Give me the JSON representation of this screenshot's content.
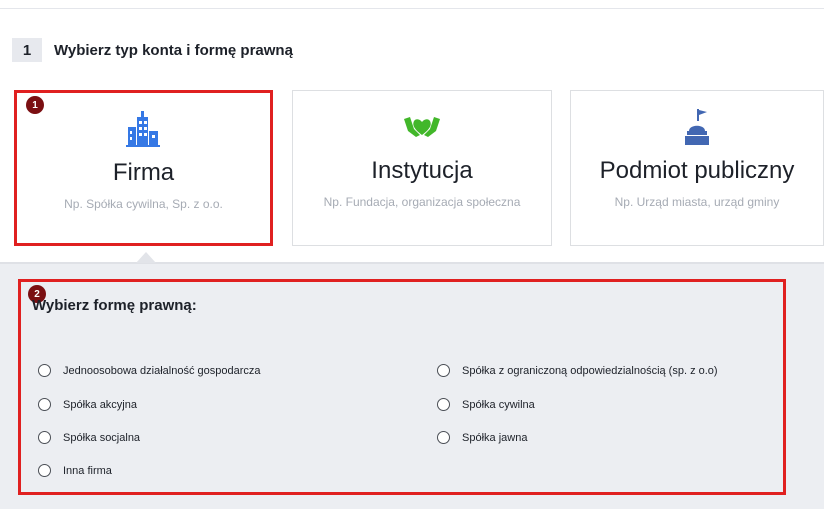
{
  "step": {
    "number": "1",
    "title": "Wybierz typ konta i formę prawną"
  },
  "account_types": [
    {
      "title": "Firma",
      "subtitle": "Np. Spółka cywilna, Sp. z o.o.",
      "icon": "building-icon",
      "selected": true
    },
    {
      "title": "Instytucja",
      "subtitle": "Np. Fundacja, organizacja społeczna",
      "icon": "hands-heart-icon",
      "selected": false
    },
    {
      "title": "Podmiot publiczny",
      "subtitle": "Np. Urząd miasta, urząd gminy",
      "icon": "town-hall-icon",
      "selected": false
    }
  ],
  "annotations": {
    "badge1": "1",
    "badge2": "2",
    "highlight_color": "#e02020",
    "badge_color": "#7b0f12"
  },
  "legal_form": {
    "title": "Wybierz formę prawną:",
    "options_left": [
      "Jednoosobowa działalność gospodarcza",
      "Spółka akcyjna",
      "Spółka socjalna",
      "Inna firma"
    ],
    "options_right": [
      "Spółka z ograniczoną odpowiedzialnością (sp. z o.o)",
      "Spółka cywilna",
      "Spółka jawna"
    ]
  },
  "colors": {
    "icon_blue": "#3578e5",
    "icon_green": "#42b72a",
    "icon_navy": "#4267b2"
  }
}
